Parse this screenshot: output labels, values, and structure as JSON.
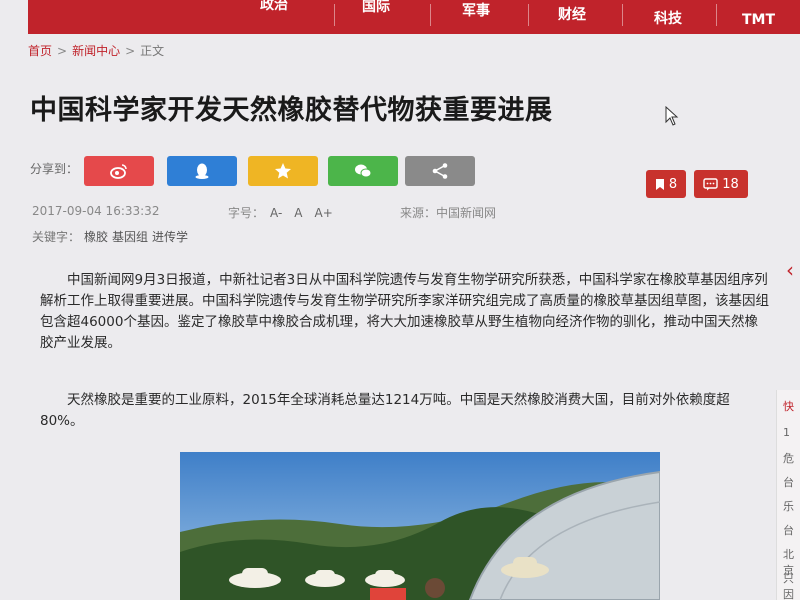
{
  "nav": {
    "items": [
      "政治",
      "国际",
      "军事",
      "财经",
      "科技",
      "TMT"
    ]
  },
  "breadcrumb": {
    "home": "首页",
    "section": "新闻中心",
    "current": "正文",
    "sep": ">"
  },
  "article": {
    "title": "中国科学家开发天然橡胶替代物获重要进展",
    "share_label": "分享到：",
    "share_icons": [
      "weibo-icon",
      "qq-icon",
      "qzone-star-icon",
      "wechat-icon",
      "share-icon"
    ],
    "share_colors": [
      "#e5494b",
      "#2f7fd6",
      "#efb524",
      "#4cb54a",
      "#8a8a8a"
    ],
    "bookmark_count": "8",
    "comment_count": "18",
    "datetime": "2017-09-04 16:33:32",
    "font_size_label": "字号：",
    "font_sizes": [
      "A-",
      "A",
      "A+"
    ],
    "source_label": "来源：",
    "source": "中国新闻网",
    "keywords_label": "关键字：",
    "keywords": [
      "橡胶",
      "基因组",
      "进传学"
    ],
    "paragraphs": [
      "中国新闻网9月3日报道，中新社记者3日从中国科学院遗传与发育生物学研究所获悉，中国科学家在橡胶草基因组序列解析工作上取得重要进展。中国科学院遗传与发育生物学研究所李家洋研究组完成了高质量的橡胶草基因组草图，该基因组包含超46000个基因。鉴定了橡胶草中橡胶合成机理，将大大加速橡胶草从野生植物向经济作物的驯化，推动中国天然橡胶产业发展。",
      "天然橡胶是重要的工业原料，2015年全球消耗总量达1214万吨。中国是天然橡胶消费大国，目前对外依赖度超80%。"
    ]
  },
  "sidebar_fragments": [
    "快",
    "1",
    "危",
    "台",
    "乐",
    "台",
    "北京",
    "只因"
  ],
  "colors": {
    "brand_red": "#c0232b",
    "badge_red": "#c8322d"
  }
}
